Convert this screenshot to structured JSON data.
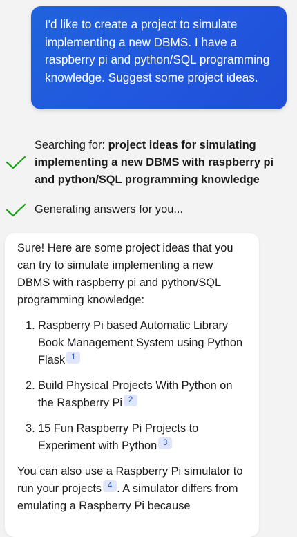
{
  "user_message": {
    "text": "I'd like to create a project to simulate implementing a new DBMS. I have a raspberry pi and python/SQL programming knowledge. Suggest some project ideas."
  },
  "status": {
    "searching_prefix": "Searching for: ",
    "searching_query": "project ideas for simulating implementing a new DBMS with raspberry pi and python/SQL programming knowledge",
    "generating": "Generating answers for you..."
  },
  "response": {
    "intro": "Sure! Here are some project ideas that you can try to simulate implementing a new DBMS with raspberry pi and python/SQL programming knowledge:",
    "items": [
      {
        "number": "1.",
        "text": "Raspberry Pi based Automatic Library Book Management System using Python Flask",
        "citation": "1"
      },
      {
        "number": "2.",
        "text": "Build Physical Projects With Python on the Raspberry Pi",
        "citation": "2"
      },
      {
        "number": "3.",
        "text": "15 Fun Raspberry Pi Projects to Experiment with Python",
        "citation": "3"
      }
    ],
    "outro_part1": "You can also use a Raspberry Pi simulator to run your projects",
    "outro_citation": "4",
    "outro_part2": ". A simulator differs from emulating a Raspberry Pi because"
  },
  "colors": {
    "user_bubble": "#2157de",
    "check_green": "#13a10e",
    "citation_bg": "#dfe6fb",
    "citation_text": "#1f49b8",
    "page_bg": "#f3f3f3"
  },
  "icons": {
    "status_check": "check-icon"
  }
}
